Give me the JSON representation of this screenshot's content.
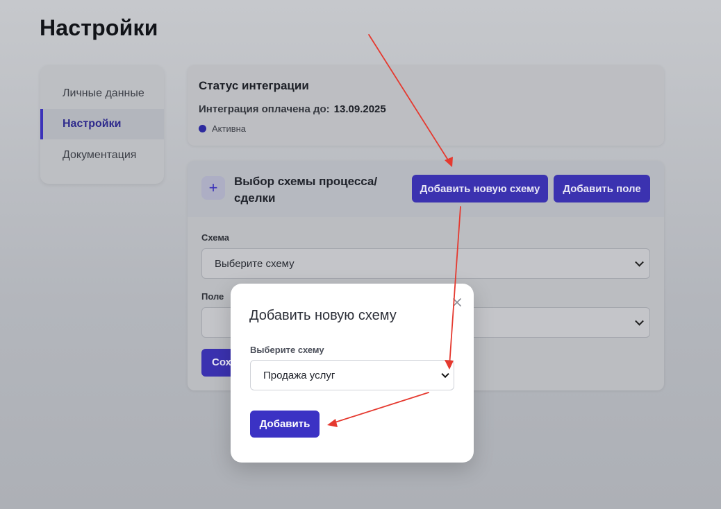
{
  "page": {
    "title": "Настройки"
  },
  "sidebar": {
    "items": [
      {
        "label": "Личные данные",
        "active": false
      },
      {
        "label": "Настройки",
        "active": true
      },
      {
        "label": "Документация",
        "active": false
      }
    ]
  },
  "status": {
    "title": "Статус интеграции",
    "paid_label": "Интеграция оплачена до:",
    "paid_date": "13.09.2025",
    "state": "Активна"
  },
  "scheme": {
    "title": "Выбор схемы процесса/ сделки",
    "add_scheme_button": "Добавить новую схему",
    "add_field_button": "Добавить поле",
    "scheme_label": "Схема",
    "scheme_select": "Выберите схему",
    "field_label": "Поле",
    "field_select": "",
    "save_button_partial": "Сох"
  },
  "modal": {
    "title": "Добавить новую схему",
    "select_label": "Выберите схему",
    "select_value": "Продажа услуг",
    "add_button": "Добавить",
    "close_icon": "close-icon"
  },
  "colors": {
    "accent": "#3b32b0",
    "annotation_arrow": "#e5392f",
    "active_dot": "#2d2a9e"
  }
}
